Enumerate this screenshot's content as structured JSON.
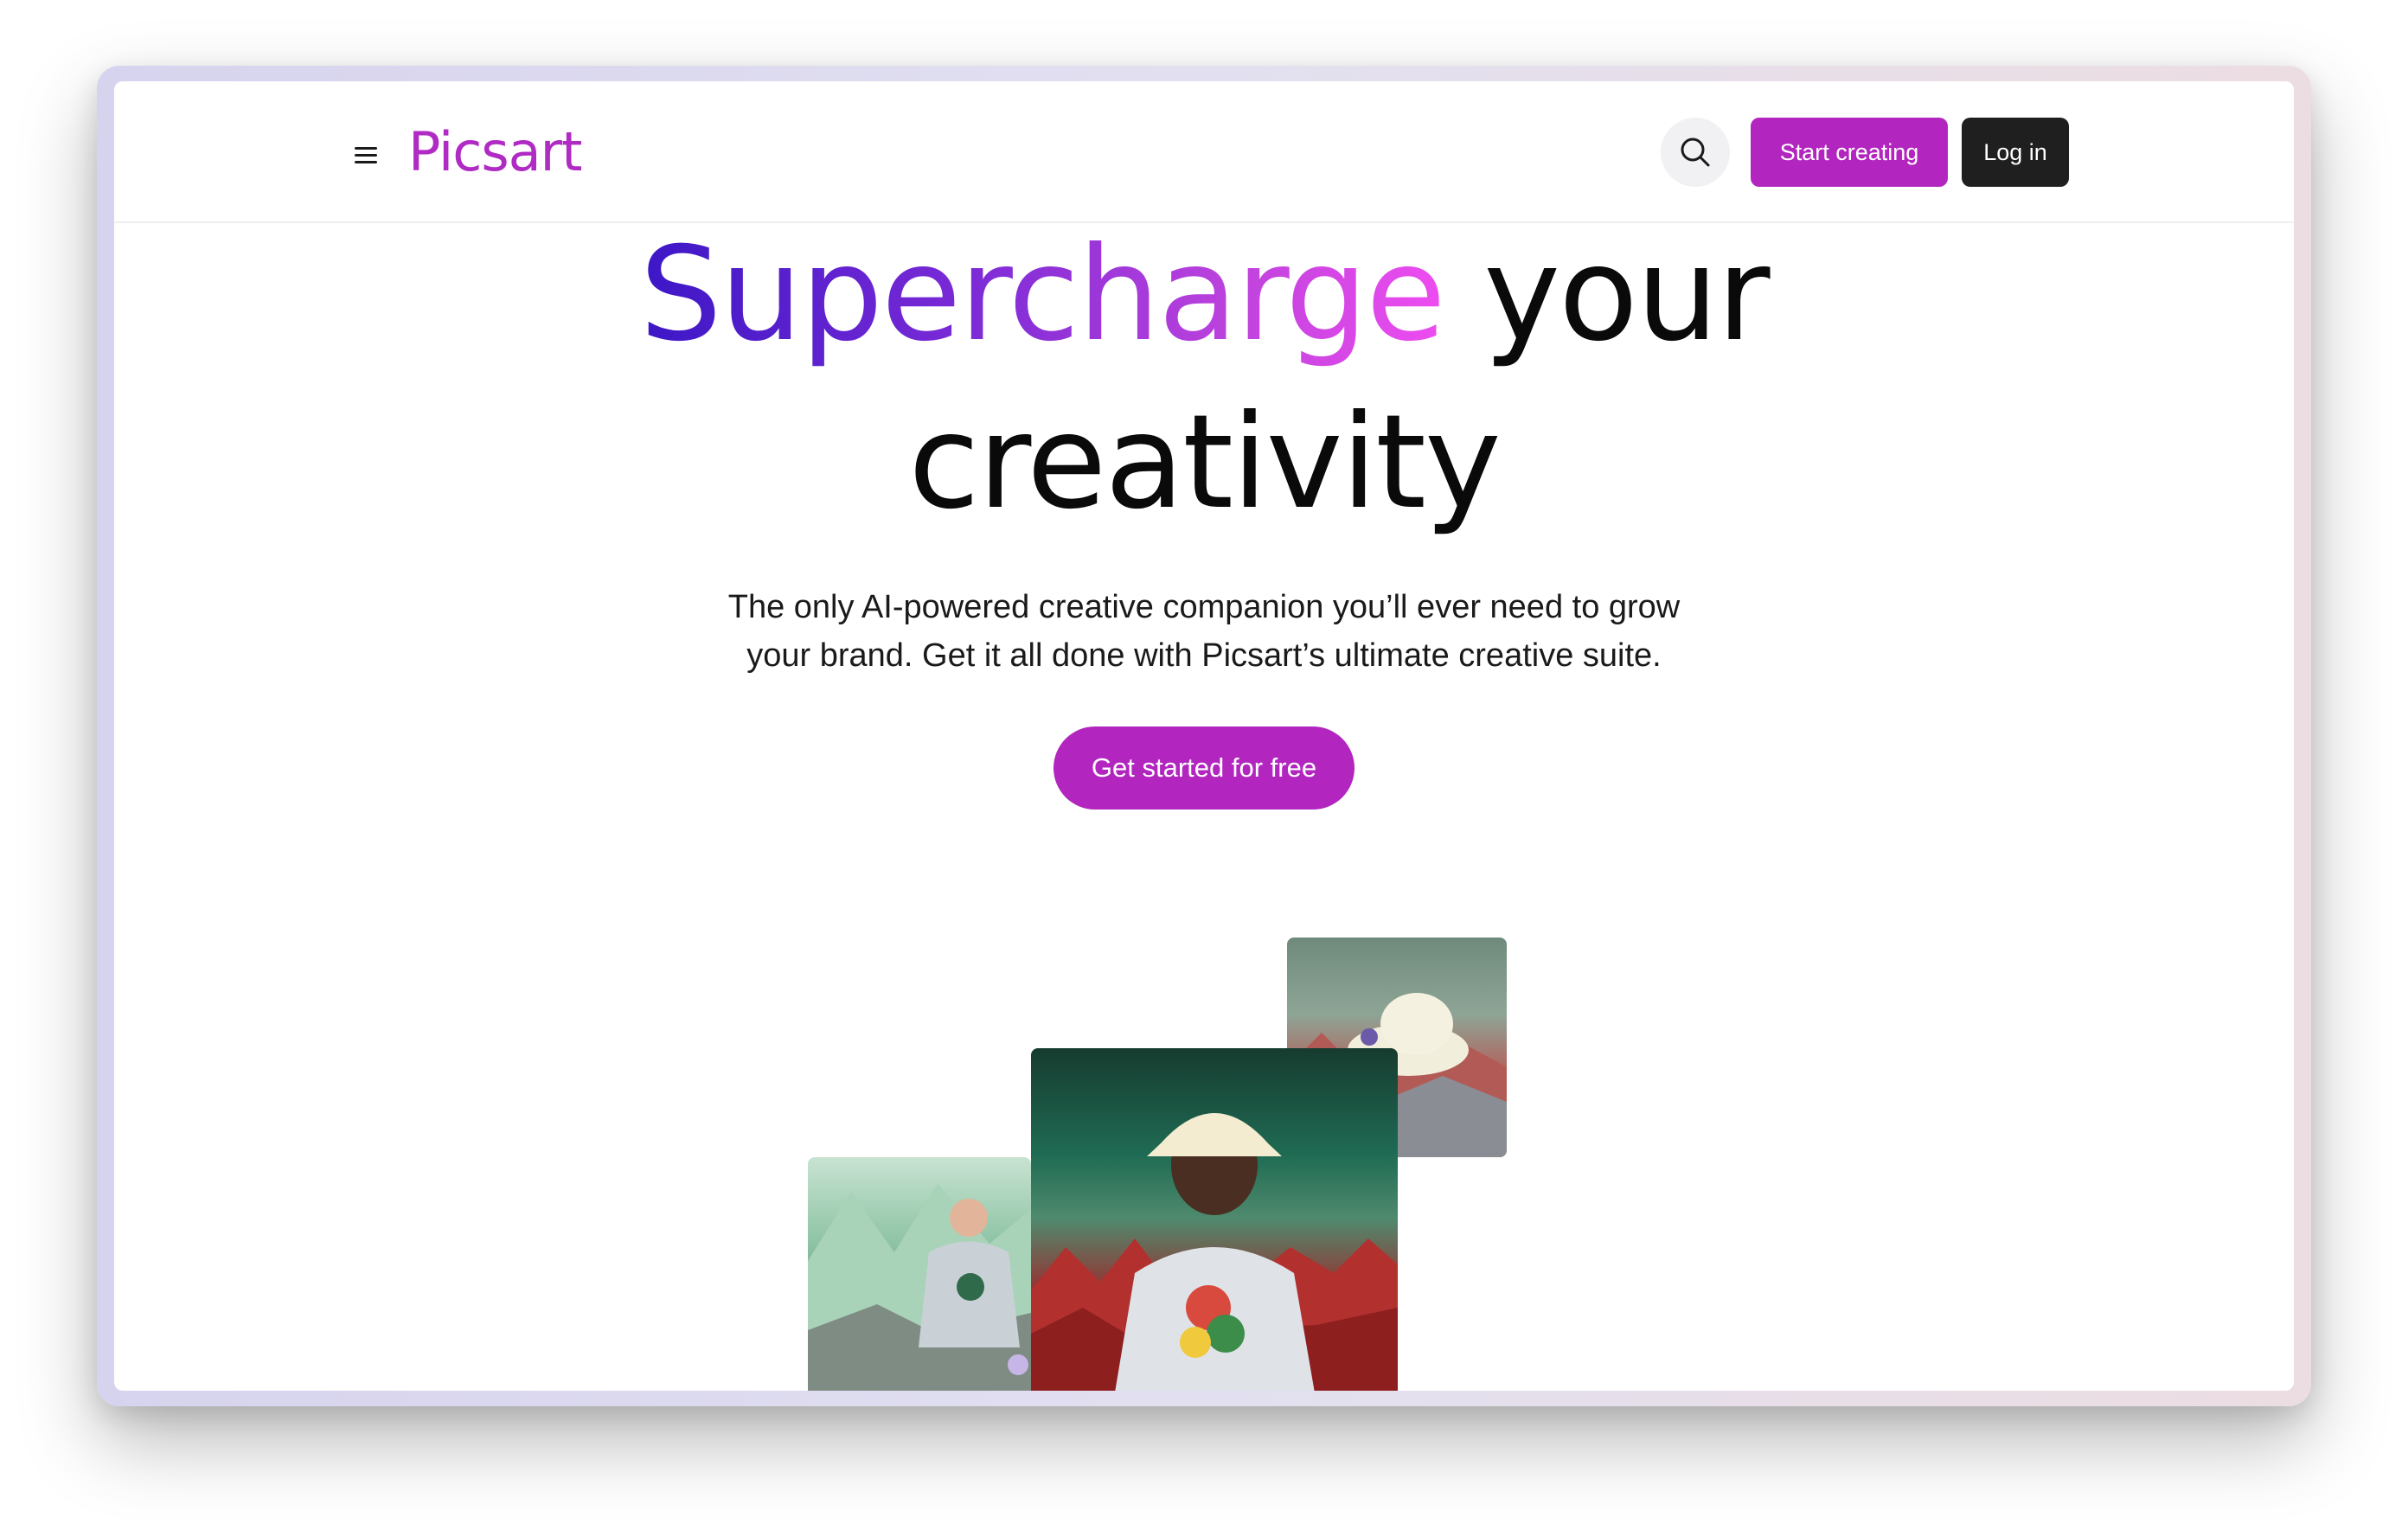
{
  "nav": {
    "brand": "Picsart",
    "start_label": "Start creating",
    "login_label": "Log in",
    "icons": {
      "menu": "hamburger-menu-icon",
      "search": "search-icon"
    }
  },
  "hero": {
    "title_highlight": "Supercharge",
    "title_rest_line1": "your",
    "title_line2": "creativity",
    "subtitle_line1": "The only AI-powered creative companion you’ll ever need to grow",
    "subtitle_line2": "your brand. Get it all done with Picsart’s ultimate creative suite.",
    "cta_label": "Get started for free"
  },
  "colors": {
    "brand": "#b226bf",
    "gradient_start": "#3c17c6",
    "gradient_end": "#ee4cf0",
    "dark_button": "#1f1f1f"
  }
}
